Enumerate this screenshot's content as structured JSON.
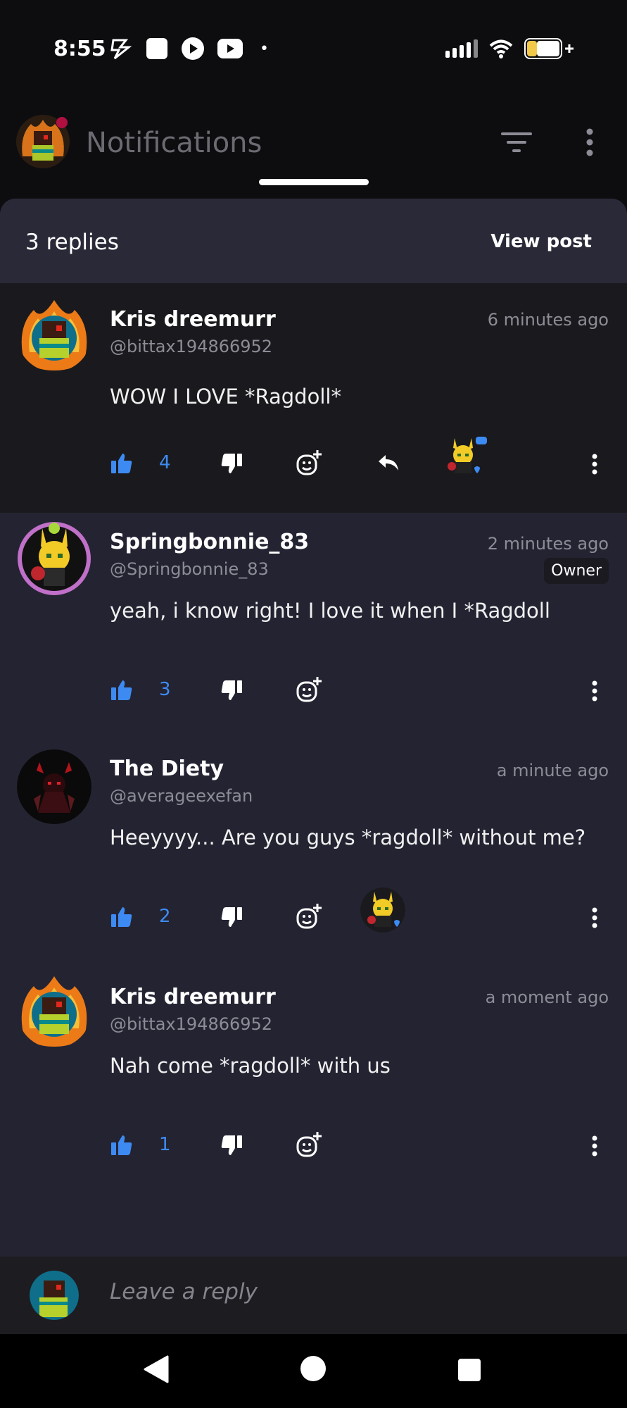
{
  "status_bar": {
    "time": "8:55",
    "dot": "•"
  },
  "header": {
    "title": "Notifications"
  },
  "sheet": {
    "replies_count": "3 replies",
    "view_post_label": "View post"
  },
  "comments": [
    {
      "name": "Kris dreemurr",
      "handle": "@bittax194866952",
      "time": "6 minutes ago",
      "text": "WOW I LOVE *Ragdoll*",
      "likes": "4",
      "badge": ""
    },
    {
      "name": "Springbonnie_83",
      "handle": "@Springbonnie_83",
      "time": "2 minutes ago",
      "text": "yeah, i know right! I love it when I *Ragdoll",
      "likes": "3",
      "badge": "Owner"
    },
    {
      "name": "The Diety",
      "handle": "@averageexefan",
      "time": "a minute ago",
      "text": "Heeyyyy... Are you guys *ragdoll* without me?",
      "likes": "2",
      "badge": ""
    },
    {
      "name": "Kris dreemurr",
      "handle": "@bittax194866952",
      "time": "a moment ago",
      "text": "Nah come *ragdoll* with us",
      "likes": "1",
      "badge": ""
    }
  ],
  "reply_bar": {
    "placeholder": "Leave a reply"
  },
  "colors": {
    "accent": "#3d8bf2",
    "sheet_bg": "#242332",
    "highlight_bg": "#1a1a1e",
    "muted_text": "#8d8c96"
  },
  "icons": [
    "bolt-icon",
    "stop-icon",
    "play-icon",
    "youtube-icon",
    "signal-icon",
    "wifi-icon",
    "battery-icon",
    "filter-icon",
    "kebab-icon",
    "thumbs-up-icon",
    "thumbs-down-icon",
    "emoji-add-icon",
    "reply-icon",
    "back-icon",
    "home-icon",
    "recents-icon"
  ]
}
